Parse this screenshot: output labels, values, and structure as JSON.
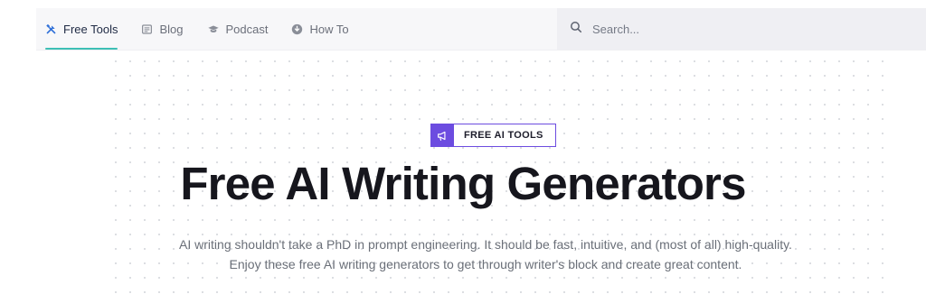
{
  "nav": {
    "tabs": [
      {
        "label": "Free Tools",
        "icon": "tools-icon",
        "active": true
      },
      {
        "label": "Blog",
        "icon": "newspaper-icon",
        "active": false
      },
      {
        "label": "Podcast",
        "icon": "graduation-cap-icon",
        "active": false
      },
      {
        "label": "How To",
        "icon": "download-circle-icon",
        "active": false
      }
    ]
  },
  "search": {
    "placeholder": "Search...",
    "icon": "search-icon"
  },
  "hero": {
    "badge_label": "FREE AI TOOLS",
    "badge_icon": "megaphone-icon",
    "title": "Free AI Writing Generators",
    "subtitle_line1": "AI writing shouldn't take a PhD in prompt engineering. It should be fast, intuitive, and (most of all) high-quality.",
    "subtitle_line2": "Enjoy these free AI writing generators to get through writer's block and create great content."
  },
  "colors": {
    "accent_underline": "#3dbfb5",
    "badge_purple": "#6c4ce0",
    "title_text": "#16161d",
    "body_text": "#6a6f78"
  }
}
